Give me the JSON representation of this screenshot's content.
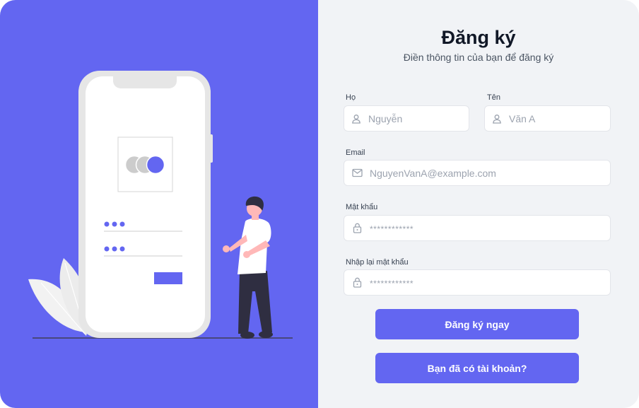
{
  "form": {
    "title": "Đăng ký",
    "subtitle": "Điền thông tin của bạn để đăng ký",
    "last_name": {
      "label": "Họ",
      "placeholder": "Nguyễn",
      "icon": "user-icon"
    },
    "first_name": {
      "label": "Tên",
      "placeholder": "Văn A",
      "icon": "user-icon"
    },
    "email": {
      "label": "Email",
      "placeholder": "NguyenVanA@example.com",
      "icon": "mail-icon"
    },
    "password": {
      "label": "Mật khẩu",
      "placeholder": "************",
      "icon": "lock-icon"
    },
    "confirm_password": {
      "label": "Nhập lại mật khẩu",
      "placeholder": "************",
      "icon": "lock-icon"
    },
    "submit_label": "Đăng ký ngay",
    "login_label": "Bạn đã có tài khoản?"
  },
  "colors": {
    "accent": "#6366f1",
    "panel_background": "#f1f3f6",
    "phone_frame": "#e6e6e6",
    "illustration_dark": "#2f2e41"
  }
}
